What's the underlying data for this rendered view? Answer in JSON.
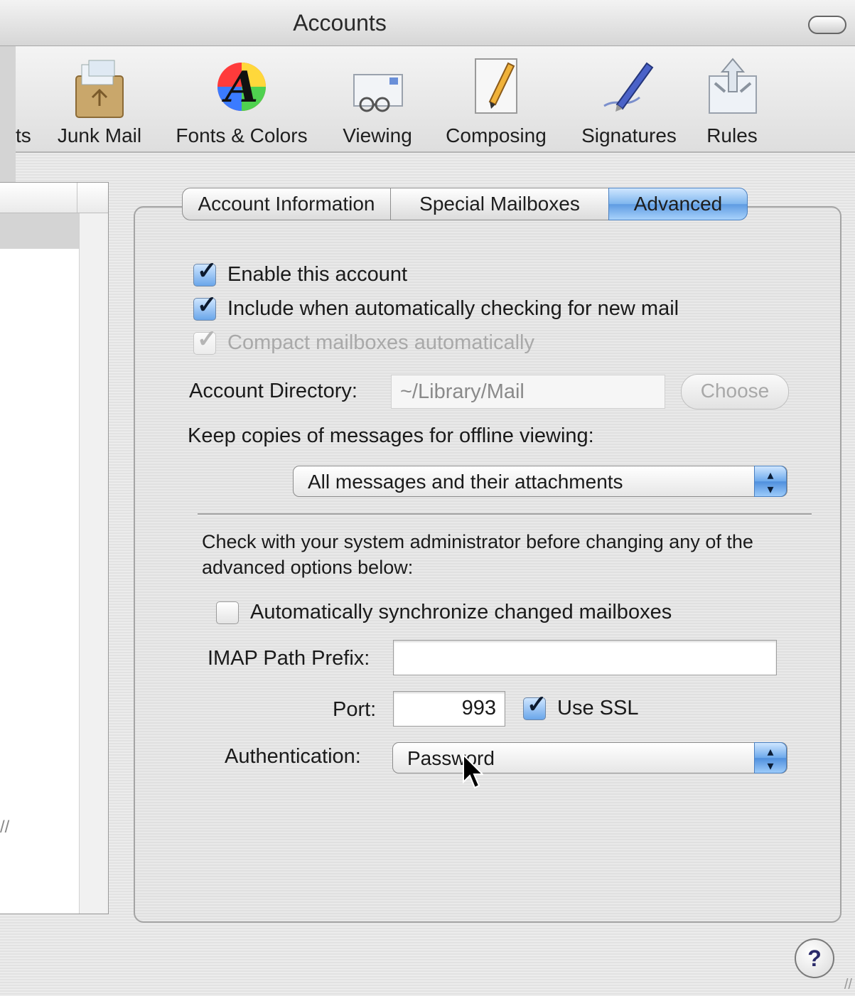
{
  "window": {
    "title": "Accounts"
  },
  "toolbar": {
    "items": [
      {
        "label": "ts",
        "icon": "accounts-icon"
      },
      {
        "label": "Junk Mail",
        "icon": "junk-mail-icon"
      },
      {
        "label": "Fonts & Colors",
        "icon": "fonts-colors-icon"
      },
      {
        "label": "Viewing",
        "icon": "viewing-icon"
      },
      {
        "label": "Composing",
        "icon": "composing-icon"
      },
      {
        "label": "Signatures",
        "icon": "signatures-icon"
      },
      {
        "label": "Rules",
        "icon": "rules-icon"
      }
    ]
  },
  "tabs": [
    {
      "label": "Account Information",
      "active": false
    },
    {
      "label": "Special Mailboxes",
      "active": false
    },
    {
      "label": "Advanced",
      "active": true
    }
  ],
  "advanced": {
    "enable_account": {
      "label": "Enable this account",
      "checked": true
    },
    "include_auto_check": {
      "label": "Include when automatically checking for new mail",
      "checked": true
    },
    "compact_mailboxes": {
      "label": "Compact mailboxes automatically",
      "checked": true,
      "disabled": true
    },
    "account_directory": {
      "label": "Account Directory:",
      "value": "~/Library/Mail",
      "button": "Choose"
    },
    "keep_copies": {
      "label": "Keep copies of messages for offline viewing:",
      "selected": "All messages and their attachments"
    },
    "note": "Check with your system administrator before changing any of the advanced options below:",
    "auto_sync": {
      "label": "Automatically synchronize changed mailboxes",
      "checked": false
    },
    "imap_prefix": {
      "label": "IMAP Path Prefix:",
      "value": ""
    },
    "port": {
      "label": "Port:",
      "value": "993"
    },
    "use_ssl": {
      "label": "Use SSL",
      "checked": true
    },
    "authentication": {
      "label": "Authentication:",
      "selected": "Password"
    }
  },
  "help": {
    "label": "?"
  },
  "colors": {
    "accent": "#6aa6ea",
    "background": "#e8e8e8"
  }
}
